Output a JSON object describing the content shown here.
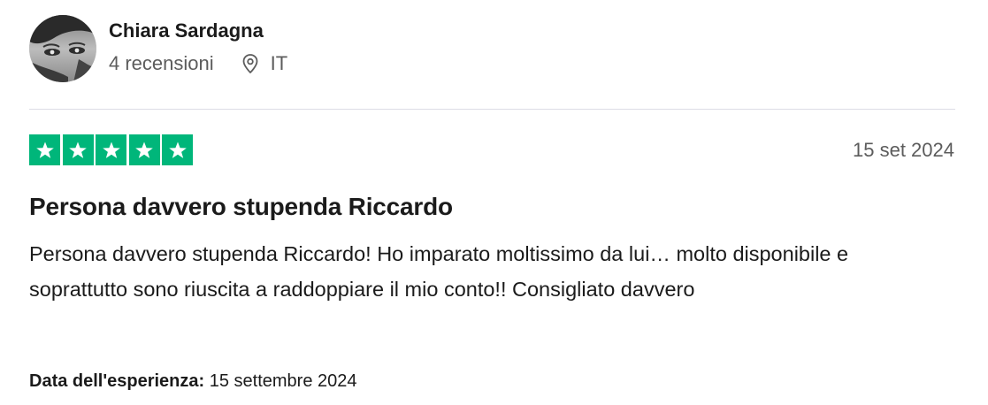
{
  "reviewer": {
    "name": "Chiara Sardagna",
    "reviews_count": "4 recensioni",
    "country": "IT"
  },
  "review": {
    "rating": 5,
    "max_rating": 5,
    "date": "15 set 2024",
    "title": "Persona davvero stupenda Riccardo",
    "body": "Persona davvero stupenda Riccardo! Ho imparato moltissimo da lui… molto disponibile e soprattutto sono riuscita a raddoppiare il mio conto!! Consigliato davvero",
    "experience_label": "Data dell'esperienza:",
    "experience_date": "15 settembre 2024"
  },
  "colors": {
    "star_green": "#00b67a",
    "text_primary": "#1b1b1b",
    "text_secondary": "#5c5c5c",
    "divider": "#dcdce6"
  },
  "icons": {
    "location": "location-pin-icon",
    "star": "star-icon"
  }
}
